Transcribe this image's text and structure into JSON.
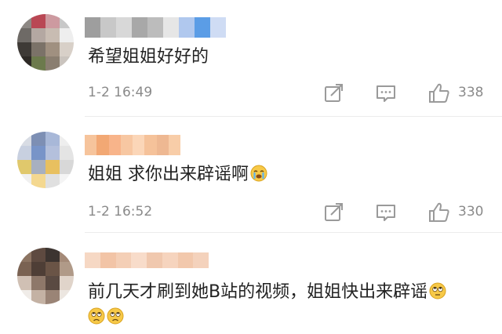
{
  "comments": [
    {
      "text": "希望姐姐好好的",
      "time": "1-2 16:49",
      "likes": "338",
      "username_pixels": [
        "#9e9e9e",
        "#c8c8c8",
        "#d8d8d8",
        "#a8a8a8",
        "#bcbcbc",
        "#e6e6e6",
        "#b0c8ee",
        "#5b9de6",
        "#cfdcf4"
      ],
      "avatar_pixels": [
        "#8d8884",
        "#b94754",
        "#cd9aa0",
        "#c8c8c8",
        "#6e6a66",
        "#b4a8a2",
        "#c8bcb2",
        "#eeeeee",
        "#3e3a36",
        "#7b7268",
        "#a09080",
        "#d8d0c8",
        "#2e2a26",
        "#6c7a4c",
        "#8a7e70",
        "#cac4be"
      ]
    },
    {
      "text": "姐姐 求你出来辟谣啊",
      "emoji_after": "crying-emoji",
      "time": "1-2 16:52",
      "likes": "330",
      "username_pixels": [
        "#f6c49c",
        "#f2a874",
        "#f8b48a",
        "#f7c7a2",
        "#fbd6b8",
        "#f5c29a",
        "#eeb892",
        "#f8cda8"
      ],
      "avatar_pixels": [
        "#d8dce4",
        "#7d8fb4",
        "#a8b8d8",
        "#eeeeee",
        "#c8d0e0",
        "#7894c8",
        "#b4c0dc",
        "#e4e4e4",
        "#e0c86c",
        "#a8b0c0",
        "#e8c060",
        "#d8d8d8",
        "#f0f0f0",
        "#f4d890",
        "#e0e0e0",
        "#f4f4f4"
      ]
    },
    {
      "text_line1": "前几天才刷到她B站的视频，姐姐快出来辟谣",
      "emoji_line1": "rolling-eyes-emoji",
      "emoji_line2": [
        "frowning-emoji",
        "frowning-emoji"
      ],
      "username_pixels": [
        "#f6d8c4",
        "#f2c4a6",
        "#f4cfb6",
        "#f8dcca",
        "#f0c8ae",
        "#f6d4be",
        "#f2c8ac",
        "#f4d2bc"
      ],
      "avatar_pixels": [
        "#8c7462",
        "#5e4a40",
        "#3c3430",
        "#a48a78",
        "#7a6252",
        "#4e3e36",
        "#6a5446",
        "#b09a88",
        "#d0c0b4",
        "#8e786a",
        "#5a4a42",
        "#e0d4ca",
        "#f0ece8",
        "#c4b2a4",
        "#9a8476",
        "#ece6e0"
      ]
    }
  ],
  "icons": {
    "share": "share-icon",
    "comment": "comment-icon",
    "like": "thumbs-up-icon"
  },
  "colors": {
    "text": "#222222",
    "meta": "#8a8a8a",
    "icon": "#9a9a9a",
    "divider": "#ececec"
  }
}
